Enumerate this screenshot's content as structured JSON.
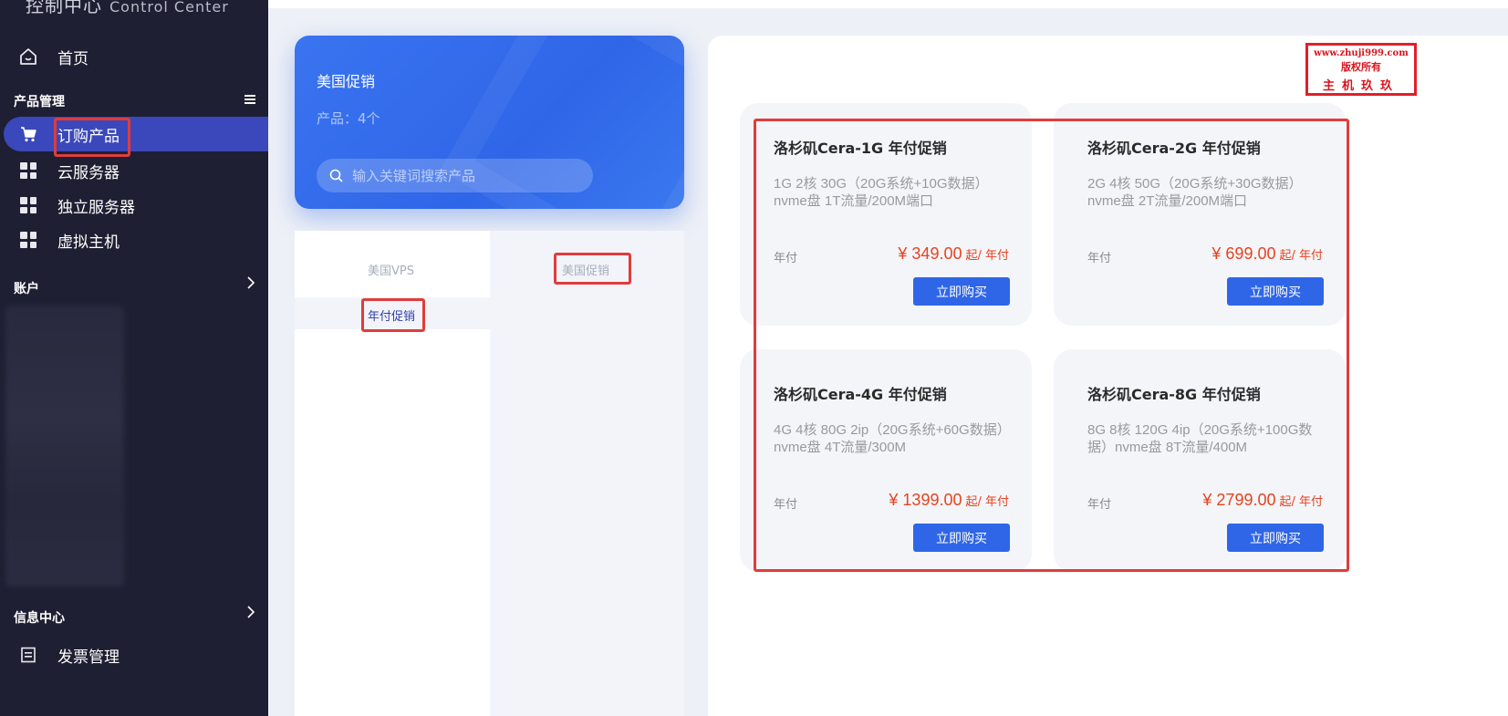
{
  "sidebar": {
    "brand": "控制中心",
    "brand_sub": "Control Center",
    "home": "首页",
    "section_product": "产品管理",
    "items": [
      {
        "label": "订购产品"
      },
      {
        "label": "云服务器"
      },
      {
        "label": "独立服务器"
      },
      {
        "label": "虚拟主机"
      }
    ],
    "section_account": "账户",
    "section_info": "信息中心",
    "invoice": "发票管理"
  },
  "banner": {
    "title": "美国促销",
    "count": "产品：4个",
    "search_placeholder": "输入关键词搜索产品"
  },
  "categories": {
    "left": "美国VPS",
    "right": "美国促销",
    "sub": "年付促销"
  },
  "products": [
    {
      "title": "洛杉矶Cera-1G 年付促销",
      "desc": "1G 2核 30G（20G系统+10G数据） nvme盘 1T流量/200M端口",
      "cycle": "年付",
      "price": "¥ 349.00",
      "unit": "起/ 年付",
      "button": "立即购买"
    },
    {
      "title": "洛杉矶Cera-2G 年付促销",
      "desc": "2G 4核 50G（20G系统+30G数据） nvme盘 2T流量/200M端口",
      "cycle": "年付",
      "price": "¥ 699.00",
      "unit": "起/ 年付",
      "button": "立即购买"
    },
    {
      "title": "洛杉矶Cera-4G 年付促销",
      "desc": "4G 4核 80G 2ip（20G系统+60G数据） nvme盘 4T流量/300M",
      "cycle": "年付",
      "price": "¥ 1399.00",
      "unit": "起/ 年付",
      "button": "立即购买"
    },
    {
      "title": "洛杉矶Cera-8G 年付促销",
      "desc": "8G  8核 120G 4ip（20G系统+100G数据）nvme盘 8T流量/400M",
      "cycle": "年付",
      "price": "¥ 2799.00",
      "unit": "起/ 年付",
      "button": "立即购买"
    }
  ],
  "watermark": {
    "line1": "www.zhuji999.com",
    "line2": "版权所有",
    "line3": "主机玖玖"
  },
  "icons": {
    "home": "home-icon",
    "menu": "menu-icon",
    "cart": "cart-icon",
    "grid": "grid-icon",
    "chevron": "chevron-right-icon",
    "invoice": "invoice-icon",
    "search": "search-icon"
  },
  "colors": {
    "sidebar_bg": "#1f1f33",
    "active_item": "#3b48bb",
    "accent": "#2f66e8",
    "price": "#e8431f",
    "highlight_border": "#e03c3c"
  }
}
